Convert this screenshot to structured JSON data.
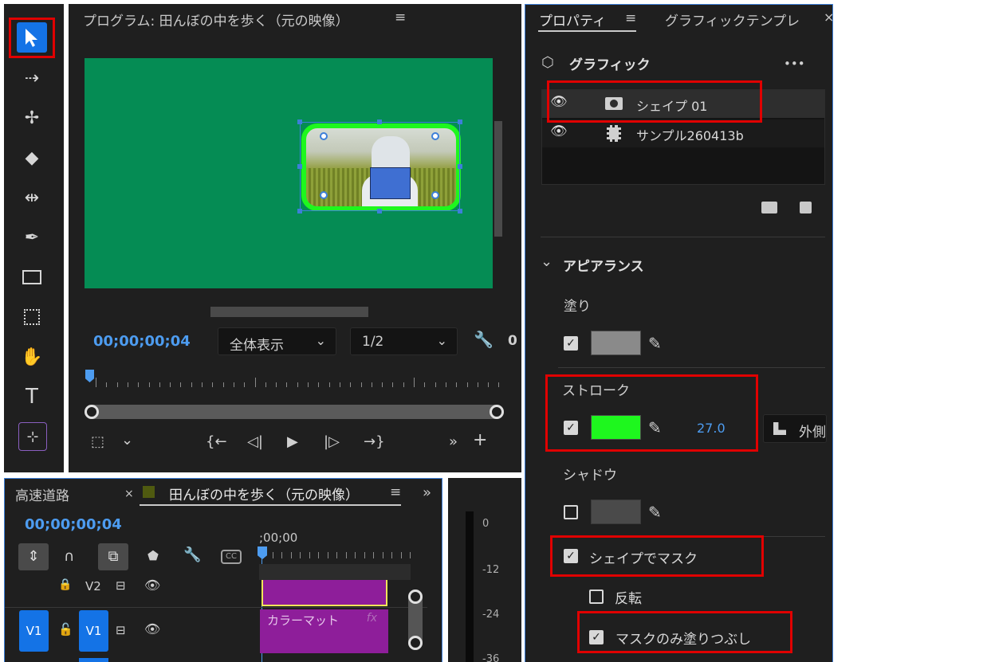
{
  "program_monitor": {
    "title": "プログラム: 田んぼの中を歩く（元の映像）",
    "timecode": "00;00;00;04",
    "zoom": "全体表示",
    "resolution": "1/2",
    "overflow_digit": "0"
  },
  "properties": {
    "tab_active": "プロパティ",
    "tab_other": "グラフィックテンプレ",
    "graphic_header": "グラフィック",
    "more": "•••",
    "layers": [
      {
        "name": "シェイプ 01"
      },
      {
        "name": "サンプル260413b"
      }
    ],
    "appearance": "アピアランス",
    "fill_label": "塗り",
    "stroke_label": "ストローク",
    "stroke_width": "27.0",
    "stroke_position": "外側",
    "shadow_label": "シャドウ",
    "mask_shape": "シェイプでマスク",
    "invert": "反転",
    "fill_mask_only": "マスクのみ塗りつぶし",
    "colors": {
      "fill": "#8a8a8a",
      "stroke": "#1ef71e",
      "shadow": "#4a4a4a"
    }
  },
  "timeline": {
    "tab_inactive": "高速道路",
    "tab_close": "×",
    "tab_active": "田んぼの中を歩く（元の映像）",
    "timecode": "00;00;00;04",
    "ruler_start": ";00;00",
    "tracks": [
      {
        "label": "V2"
      },
      {
        "label": "V1",
        "source": "V1"
      }
    ],
    "clip_name": "カラーマット",
    "clip_fx": "fx",
    "ccap": "CC"
  },
  "meter": {
    "ticks": [
      "0",
      "-12",
      "-24",
      "-36"
    ]
  }
}
